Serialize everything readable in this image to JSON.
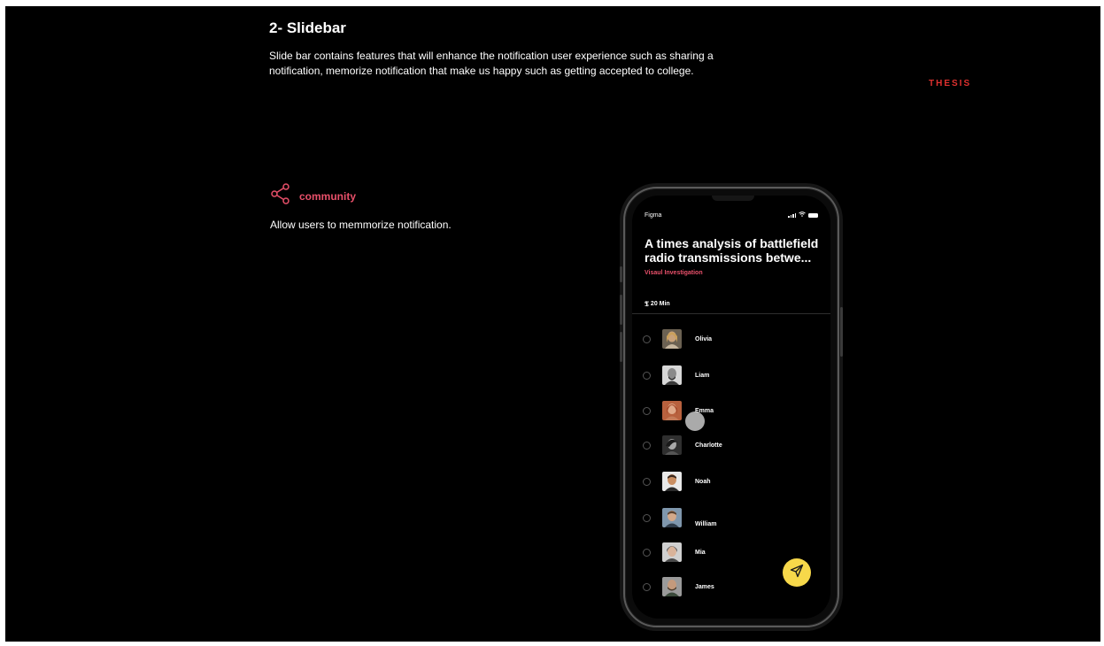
{
  "slide": {
    "heading": "2- Slidebar",
    "description": "Slide bar contains features that will enhance the notification user experience such as sharing a notification, memorize notification that make us happy such as getting accepted to college.",
    "brand": "THESIS"
  },
  "feature": {
    "icon": "share-icon",
    "label": "community",
    "description": "Allow users to memmorize notification."
  },
  "phone": {
    "status_app": "Figma",
    "article": {
      "title": "A times analysis of battlefield radio transmissions betwe...",
      "category": "Visaul Investigation",
      "read_time": "20 Min"
    },
    "contacts": [
      {
        "name": "Olivia",
        "selected": false
      },
      {
        "name": "Liam",
        "selected": false
      },
      {
        "name": "Emma",
        "selected": false
      },
      {
        "name": "Charlotte",
        "selected": false
      },
      {
        "name": "Noah",
        "selected": false
      },
      {
        "name": "William",
        "selected": false
      },
      {
        "name": "Mia",
        "selected": false
      },
      {
        "name": "James",
        "selected": false
      }
    ],
    "send_icon": "send-icon"
  },
  "colors": {
    "accent": "#e8506a",
    "brand": "#e0312f",
    "send": "#f7d84a",
    "background": "#000000"
  }
}
